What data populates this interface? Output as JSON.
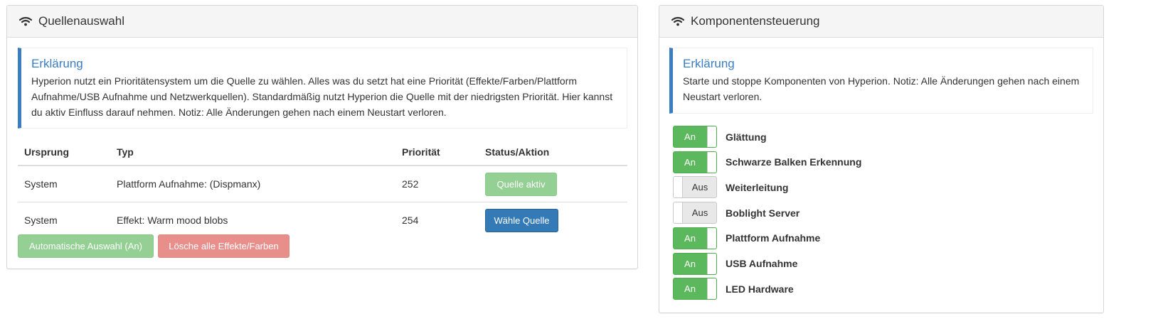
{
  "left_panel": {
    "title": "Quellenauswahl",
    "icon": "wifi-icon",
    "callout": {
      "heading": "Erklärung",
      "text": "Hyperion nutzt ein Prioritätensystem um die Quelle zu wählen. Alles was du setzt hat eine Priorität (Effekte/Farben/Plattform Aufnahme/USB Aufnahme und Netzwerkquellen). Standardmäßig nutzt Hyperion die Quelle mit der niedrigsten Priorität. Hier kannst du aktiv Einfluss darauf nehmen. Notiz: Alle Änderungen gehen nach einem Neustart verloren."
    },
    "table": {
      "headers": [
        "Ursprung",
        "Typ",
        "Priorität",
        "Status/Aktion"
      ],
      "rows": [
        {
          "origin": "System",
          "type": "Plattform Aufnahme: (Dispmanx)",
          "priority": "252",
          "action": "Quelle aktiv"
        },
        {
          "origin": "System",
          "type": "Effekt: Warm mood blobs",
          "priority": "254",
          "action": "Wähle Quelle"
        }
      ]
    },
    "buttons": {
      "auto_select": "Automatische Auswahl (An)",
      "clear_all": "Lösche alle Effekte/Farben"
    }
  },
  "right_panel": {
    "title": "Komponentensteuerung",
    "icon": "wifi-icon",
    "callout": {
      "heading": "Erklärung",
      "text": "Starte und stoppe Komponenten von Hyperion. Notiz: Alle Änderungen gehen nach einem Neustart verloren."
    },
    "components": [
      {
        "label": "Glättung",
        "state": "An",
        "on": true
      },
      {
        "label": "Schwarze Balken Erkennung",
        "state": "An",
        "on": true
      },
      {
        "label": "Weiterleitung",
        "state": "Aus",
        "on": false
      },
      {
        "label": "Boblight Server",
        "state": "Aus",
        "on": false
      },
      {
        "label": "Plattform Aufnahme",
        "state": "An",
        "on": true
      },
      {
        "label": "USB Aufnahme",
        "state": "An",
        "on": true
      },
      {
        "label": "LED Hardware",
        "state": "An",
        "on": true
      }
    ]
  },
  "colors": {
    "accent": "#337ab7",
    "callout_border": "#3a7dc0",
    "success": "#5cb85c",
    "danger": "#e88f8c"
  }
}
